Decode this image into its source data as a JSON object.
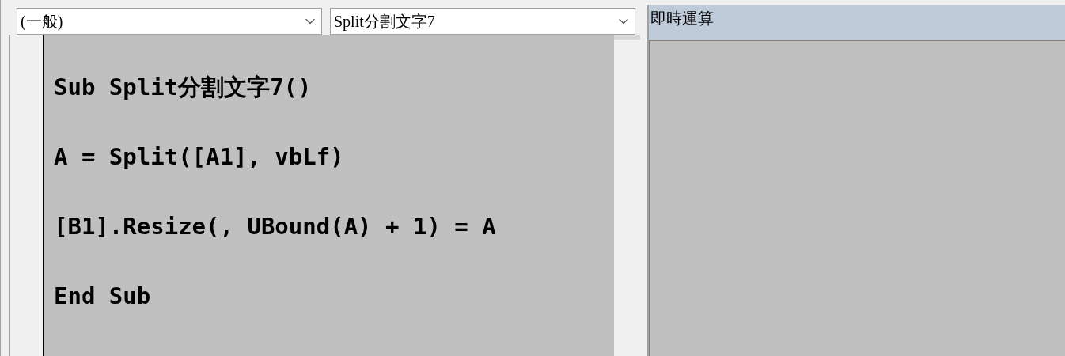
{
  "code_window": {
    "object_dropdown": {
      "value": "(一般)"
    },
    "procedure_dropdown": {
      "value": "Split分割文字7"
    },
    "code_lines": [
      "Sub Split分割文字7()",
      "A = Split([A1], vbLf)",
      "[B1].Resize(, UBound(A) + 1) = A",
      "End Sub"
    ]
  },
  "immediate_window": {
    "title": "即時運算"
  }
}
